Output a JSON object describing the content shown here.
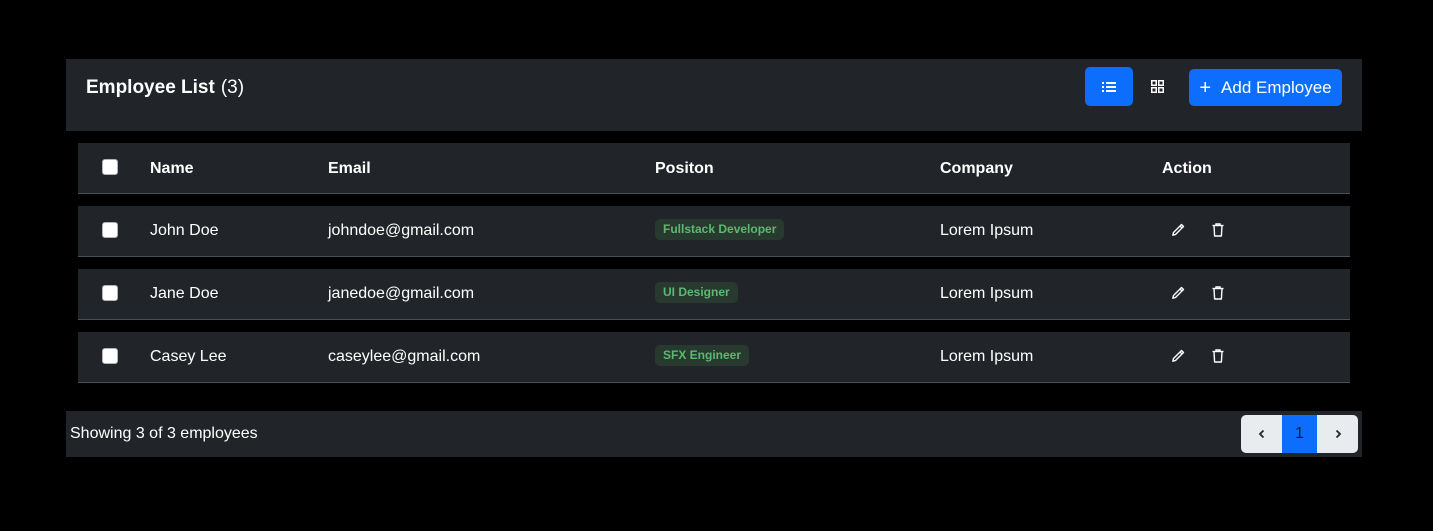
{
  "header": {
    "title": "Employee List",
    "count": "(3)",
    "add_label": "Add Employee"
  },
  "table": {
    "columns": [
      "Name",
      "Email",
      "Positon",
      "Company",
      "Action"
    ],
    "rows": [
      {
        "name": "John Doe",
        "email": "johndoe@gmail.com",
        "position": "Fullstack Developer",
        "company": "Lorem Ipsum"
      },
      {
        "name": "Jane Doe",
        "email": "janedoe@gmail.com",
        "position": "UI Designer",
        "company": "Lorem Ipsum"
      },
      {
        "name": "Casey Lee",
        "email": "caseylee@gmail.com",
        "position": "SFX Engineer",
        "company": "Lorem Ipsum"
      }
    ]
  },
  "footer": {
    "info": "Showing 3 of 3 employees",
    "page": "1"
  },
  "colors": {
    "accent": "#0d6efd",
    "panel": "#212529",
    "badge_text": "#5bb970"
  },
  "icons": [
    "list-icon",
    "grid-icon",
    "plus-icon",
    "pencil-icon",
    "trash-icon",
    "chevron-left-icon",
    "chevron-right-icon"
  ]
}
